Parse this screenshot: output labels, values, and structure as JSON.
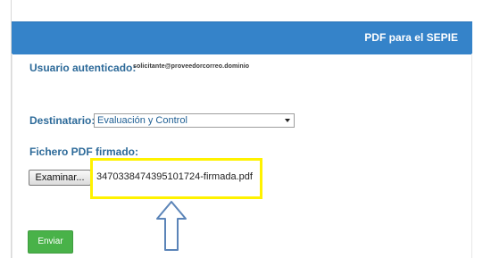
{
  "header": {
    "title": "PDF para el SEPIE"
  },
  "user": {
    "label": "Usuario autenticado:",
    "value": "solicitante@proveedorcorreo.dominio"
  },
  "recipient": {
    "label": "Destinatario:",
    "selected": "Evaluación y Control"
  },
  "file": {
    "label": "Fichero PDF firmado:",
    "browse_label": "Examinar...",
    "selected_file": "3470338474395101724-firmada.pdf"
  },
  "actions": {
    "submit_label": "Enviar"
  },
  "annotations": {
    "highlight_color": "#fff200",
    "arrow_icon": "up-arrow-outline-icon"
  },
  "colors": {
    "header_blue": "#3583c9",
    "label_blue": "#2d6a99",
    "submit_green": "#49b249"
  }
}
